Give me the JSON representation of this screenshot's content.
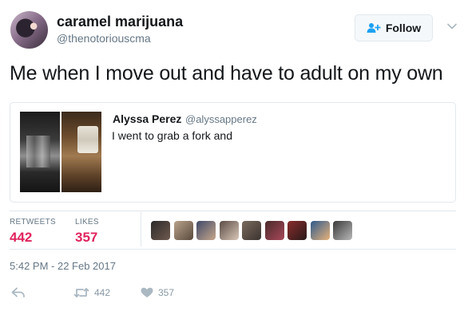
{
  "author": {
    "display_name": "caramel marijuana",
    "handle": "@thenotoriouscma"
  },
  "follow_button": {
    "label": "Follow"
  },
  "tweet": {
    "text": "Me when I move out and have to adult on my own"
  },
  "quoted_tweet": {
    "display_name": "Alyssa Perez",
    "handle": "@alyssapperez",
    "text": "I went to grab a fork and"
  },
  "stats": {
    "retweets_label": "RETWEETS",
    "retweets_count": "442",
    "likes_label": "LIKES",
    "likes_count": "357"
  },
  "liker_avatars": [
    {
      "colors": [
        "#2d2a2a",
        "#6e5a4e"
      ]
    },
    {
      "colors": [
        "#b9a38c",
        "#5b4a3d"
      ]
    },
    {
      "colors": [
        "#3f4a6a",
        "#c7a68a"
      ]
    },
    {
      "colors": [
        "#5a4b44",
        "#d9c7b8"
      ]
    },
    {
      "colors": [
        "#7a6a5c",
        "#3b3330"
      ]
    },
    {
      "colors": [
        "#4a2a2a",
        "#a8485a"
      ]
    },
    {
      "colors": [
        "#8a2c2c",
        "#2a1a1a"
      ]
    },
    {
      "colors": [
        "#2f5a8c",
        "#e8b27a"
      ]
    },
    {
      "colors": [
        "#3a3a3a",
        "#b8b8b8"
      ]
    }
  ],
  "timestamp": "5:42 PM - 22 Feb 2017",
  "actions": {
    "reply_icon": "reply-icon",
    "retweet_count": "442",
    "like_count": "357"
  },
  "colors": {
    "like_pink": "#e0245e",
    "muted": "#657786",
    "border": "#e1e8ed"
  }
}
